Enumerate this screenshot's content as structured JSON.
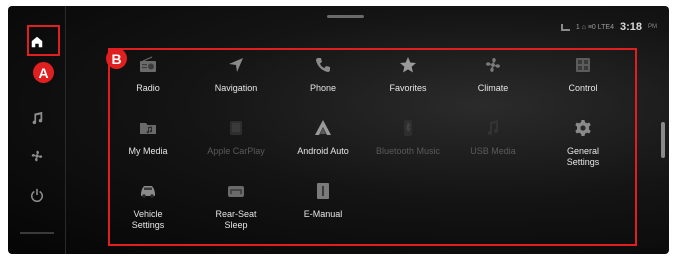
{
  "status": {
    "signal_text": "1 ⌂ ≡0 LTE4",
    "time": "3:18",
    "ampm": "PM"
  },
  "sidebar": {
    "items": [
      {
        "icon": "home-icon",
        "active": true
      },
      {
        "icon": "music-icon"
      },
      {
        "icon": "fan-icon"
      },
      {
        "icon": "power-icon"
      }
    ]
  },
  "callouts": {
    "a": "A",
    "b": "B"
  },
  "colors": {
    "highlight": "#e02020",
    "label": "#e6e6e6",
    "disabled": "#5a5a5a"
  },
  "apps": [
    {
      "label": "Radio",
      "icon": "radio-icon",
      "enabled": true
    },
    {
      "label": "Navigation",
      "icon": "navigation-icon",
      "enabled": true
    },
    {
      "label": "Phone",
      "icon": "phone-icon",
      "enabled": true
    },
    {
      "label": "Favorites",
      "icon": "star-icon",
      "enabled": true
    },
    {
      "label": "Climate",
      "icon": "fan-icon",
      "enabled": true
    },
    {
      "label": "Control",
      "icon": "control-icon",
      "enabled": true
    },
    {
      "label": "My Media",
      "icon": "folder-icon",
      "enabled": true
    },
    {
      "label": "Apple CarPlay",
      "icon": "carplay-icon",
      "enabled": false
    },
    {
      "label": "Android Auto",
      "icon": "android-auto-icon",
      "enabled": true
    },
    {
      "label": "Bluetooth Music",
      "icon": "bluetooth-icon",
      "enabled": false
    },
    {
      "label": "USB Media",
      "icon": "usb-music-icon",
      "enabled": false
    },
    {
      "label": "General\nSettings",
      "icon": "gear-icon",
      "enabled": true
    },
    {
      "label": "Vehicle\nSettings",
      "icon": "car-icon",
      "enabled": true
    },
    {
      "label": "Rear-Seat\nSleep",
      "icon": "rear-seat-icon",
      "enabled": true
    },
    {
      "label": "E-Manual",
      "icon": "book-icon",
      "enabled": true
    }
  ]
}
